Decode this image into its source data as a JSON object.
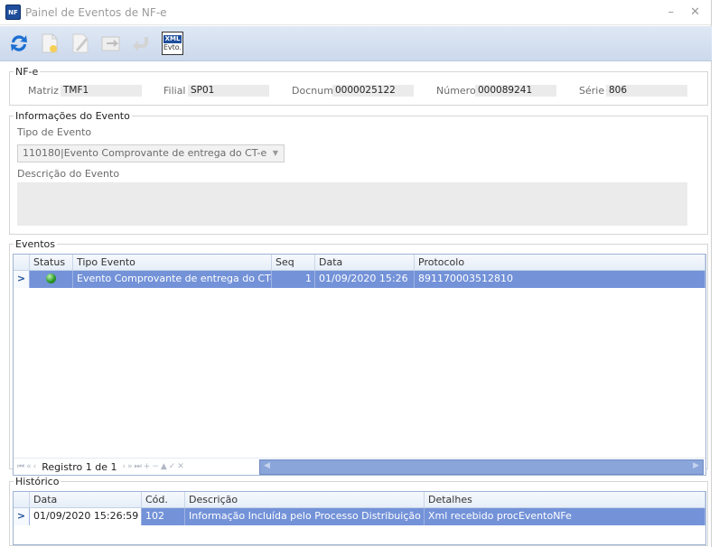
{
  "window": {
    "title": "Painel de Eventos de NF-e",
    "icon_text": "NF",
    "minimize": "–",
    "close": "✕"
  },
  "toolbar": {
    "buttons": [
      {
        "name": "refresh-icon"
      },
      {
        "name": "new-document-icon"
      },
      {
        "name": "edit-icon"
      },
      {
        "name": "send-icon"
      },
      {
        "name": "undo-icon"
      }
    ],
    "xml_top": "XML",
    "xml_bottom": "Evto."
  },
  "nfe": {
    "legend": "NF-e",
    "matriz_label": "Matriz",
    "matriz_value": "TMF1",
    "filial_label": "Filial",
    "filial_value": "SP01",
    "docnum_label": "Docnum",
    "docnum_value": "0000025122",
    "numero_label": "Número",
    "numero_value": "000089241",
    "serie_label": "Série",
    "serie_value": "806"
  },
  "evento_info": {
    "legend": "Informações do Evento",
    "tipo_label": "Tipo de Evento",
    "tipo_value": "110180|Evento Comprovante de entrega do CT-e",
    "desc_label": "Descrição do Evento"
  },
  "eventos": {
    "legend": "Eventos",
    "columns": [
      "Status",
      "Tipo Evento",
      "Seq",
      "Data",
      "Protocolo"
    ],
    "rows": [
      {
        "indicator": ">",
        "tipo": "Evento Comprovante de entrega do CT-e",
        "seq": "1",
        "data": "01/09/2020 15:26",
        "protocolo": "891170003512810"
      }
    ],
    "nav_record": "Registro 1 de 1"
  },
  "historico": {
    "legend": "Histórico",
    "columns": [
      "Data",
      "Cód.",
      "Descrição",
      "Detalhes"
    ],
    "rows": [
      {
        "indicator": ">",
        "data": "01/09/2020 15:26:59",
        "cod": "102",
        "descricao": "Informação Incluída pelo Processo Distribuição de ...",
        "detalhes": "Xml recebido procEventoNFe"
      }
    ]
  }
}
